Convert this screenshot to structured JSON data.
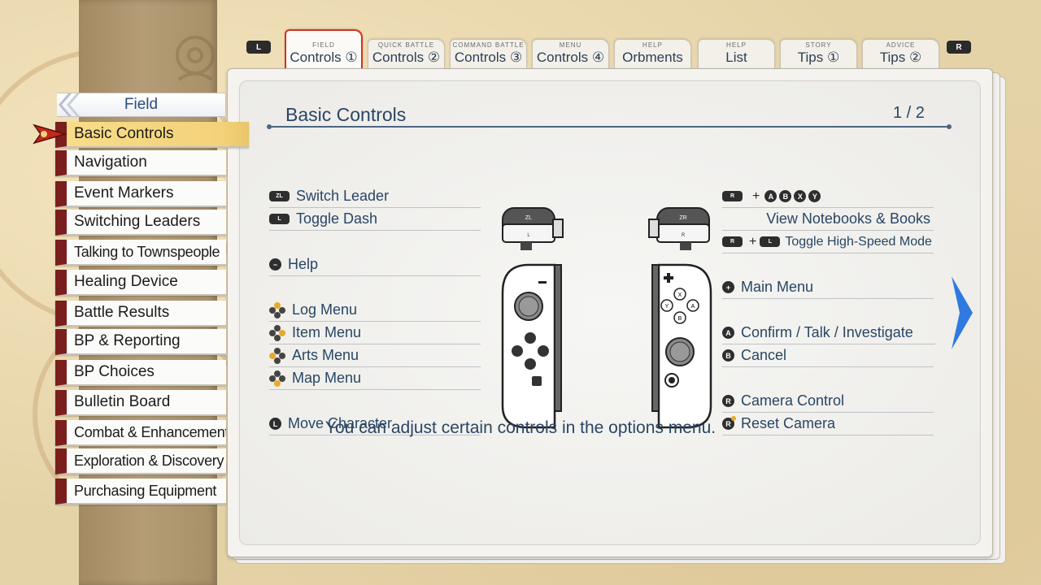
{
  "shoulder_buttons": {
    "left": "L",
    "right": "R"
  },
  "tabs": [
    {
      "category": "FIELD",
      "name": "Controls ①",
      "active": true
    },
    {
      "category": "QUICK BATTLE",
      "name": "Controls ②"
    },
    {
      "category": "COMMAND BATTLE",
      "name": "Controls ③"
    },
    {
      "category": "MENU",
      "name": "Controls ④"
    },
    {
      "category": "HELP",
      "name": "Orbments"
    },
    {
      "category": "HELP",
      "name": "List"
    },
    {
      "category": "STORY",
      "name": "Tips ①"
    },
    {
      "category": "ADVICE",
      "name": "Tips ②"
    }
  ],
  "sidebar": {
    "header": "Field",
    "selected_index": 0,
    "items": [
      "Basic Controls",
      "Navigation",
      "Event Markers",
      "Switching Leaders",
      "Talking to Townspeople",
      "Healing Device",
      "Battle Results",
      "BP & Reporting",
      "BP Choices",
      "Bulletin Board",
      "Combat & Enhancement",
      "Exploration & Discovery",
      "Purchasing Equipment"
    ]
  },
  "page": {
    "title": "Basic Controls",
    "page_number": "1 / 2",
    "hint": "You can adjust certain controls in the options menu."
  },
  "left_controls": {
    "switch_leader": {
      "icon": "ZL",
      "label": "Switch Leader"
    },
    "toggle_dash": {
      "icon": "L",
      "label": "Toggle Dash"
    },
    "help": {
      "icon": "minus",
      "label": "Help"
    },
    "log_menu": {
      "icon": "dpad-up",
      "label": "Log Menu"
    },
    "item_menu": {
      "icon": "dpad-right",
      "label": "Item Menu"
    },
    "arts_menu": {
      "icon": "dpad-left",
      "label": "Arts Menu"
    },
    "map_menu": {
      "icon": "dpad-down",
      "label": "Map Menu"
    },
    "move_character": {
      "icon": "L-stick",
      "label": "Move Character"
    }
  },
  "right_controls": {
    "notebooks_combo": {
      "button": "R",
      "plus": "+",
      "faces": [
        "A",
        "B",
        "X",
        "Y"
      ]
    },
    "notebooks_label": "View Notebooks & Books",
    "high_speed": {
      "button1": "R",
      "plus": "+",
      "button2": "L",
      "label": "Toggle High-Speed Mode"
    },
    "main_menu": {
      "icon": "plus",
      "label": "Main Menu"
    },
    "confirm": {
      "icon": "A",
      "label": "Confirm / Talk / Investigate"
    },
    "cancel": {
      "icon": "B",
      "label": "Cancel"
    },
    "camera_control": {
      "icon": "R-stick",
      "label": "Camera Control"
    },
    "reset_camera": {
      "icon": "R-stick-press",
      "label": "Reset Camera"
    }
  },
  "joycons": {
    "left": {
      "trigger": "ZL",
      "shoulder": "L"
    },
    "right": {
      "trigger": "ZR",
      "shoulder": "R",
      "face": [
        "X",
        "Y",
        "A",
        "B"
      ]
    }
  },
  "colors": {
    "accent_red": "#d2321c",
    "sidebar_selected": "#f3d27a",
    "sidebar_stripe": "#7a1e1e",
    "text_blue": "#284664",
    "arrow_blue": "#2e7ae0"
  }
}
